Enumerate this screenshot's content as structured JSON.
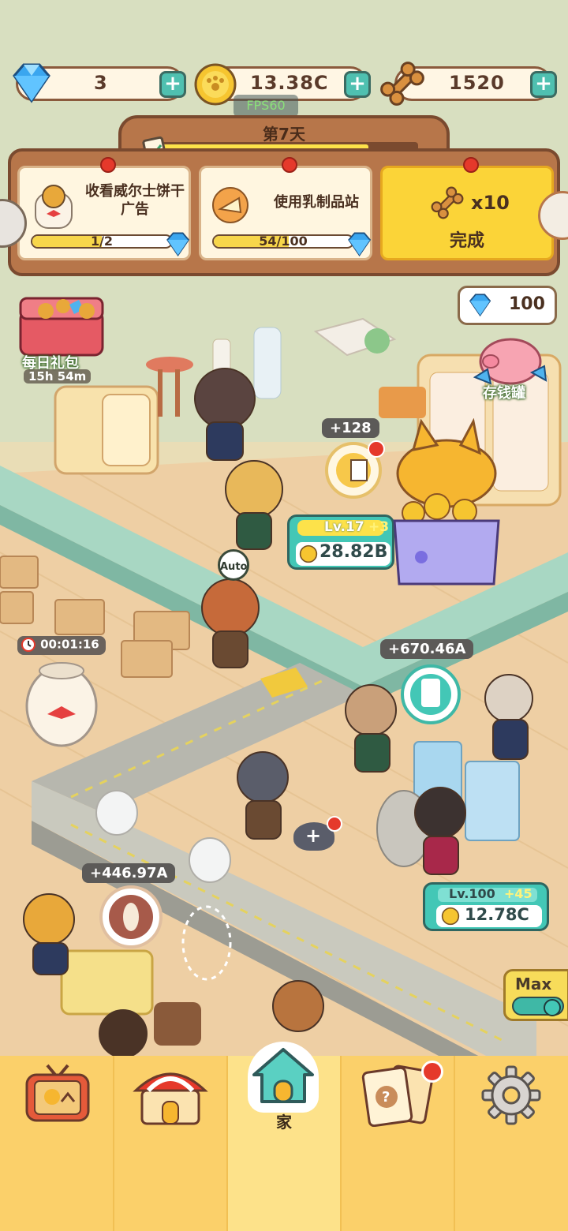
{
  "currency": {
    "gems": "3",
    "coins": "13.38C",
    "bones": "1520",
    "fps_badge": "FPS60"
  },
  "day": {
    "label": "第7天",
    "progress": 0.82
  },
  "quests": [
    {
      "title": "收看威尔士饼干广告",
      "progress_text": "1/2",
      "progress": 0.5
    },
    {
      "title": "使用乳制品站",
      "progress_text": "54/100",
      "progress": 0.54
    },
    {
      "reward": "x10",
      "status": "完成"
    }
  ],
  "daily_gift": {
    "label": "每日礼包",
    "timer": "15h 54m"
  },
  "piggy_bank": {
    "amount": "100",
    "label": "存钱罐"
  },
  "stations": {
    "top": {
      "bubble": "+128",
      "level": "Lv.17",
      "level_bonus": "+3",
      "income": "28.82B",
      "auto": "Auto"
    },
    "milk": {
      "bubble": "+670.46A",
      "level": "Lv.100",
      "level_bonus": "+45",
      "income": "12.78C"
    },
    "coffee": {
      "bubble": "+446.97A"
    }
  },
  "jar_timer": "00:01:16",
  "max_toggle": {
    "label": "Max",
    "on": true
  },
  "nav": {
    "home_label": "家"
  },
  "colors": {
    "nav_bg": "#fbd06a",
    "teal": "#43c7b6",
    "wood": "#b7764a",
    "gold": "#f7d64a"
  }
}
